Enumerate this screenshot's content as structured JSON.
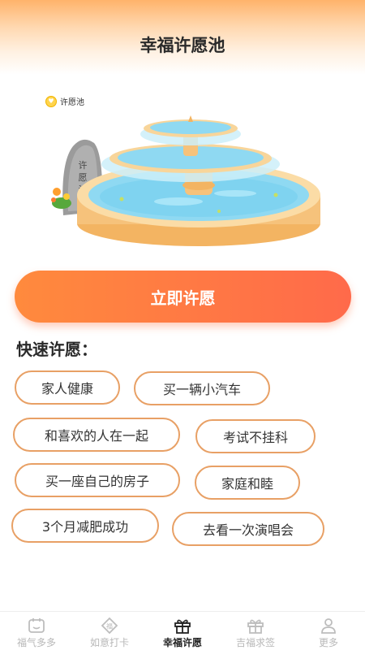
{
  "header": {
    "title": "幸福许愿池"
  },
  "scene": {
    "tag_label": "许愿池",
    "stone_text": [
      "许",
      "愿",
      "池"
    ]
  },
  "cta": {
    "label": "立即许愿"
  },
  "quick": {
    "title": "快速许愿：",
    "chips": [
      "家人健康",
      "买一辆小汽车",
      "和喜欢的人在一起",
      "考试不挂科",
      "买一座自己的房子",
      "家庭和睦",
      "3个月减肥成功",
      "去看一次演唱会"
    ]
  },
  "tabbar": {
    "items": [
      {
        "label": "福气多多",
        "icon": "calendar-icon",
        "active": false
      },
      {
        "label": "如意打卡",
        "icon": "fu-badge-icon",
        "active": false
      },
      {
        "label": "幸福许愿",
        "icon": "gift-icon",
        "active": true
      },
      {
        "label": "吉福求签",
        "icon": "gift-box-icon",
        "active": false
      },
      {
        "label": "更多",
        "icon": "user-icon",
        "active": false
      }
    ]
  },
  "colors": {
    "accent": "#ff7a42",
    "chip_border": "#e8a065",
    "water": "#7fd3f0"
  }
}
